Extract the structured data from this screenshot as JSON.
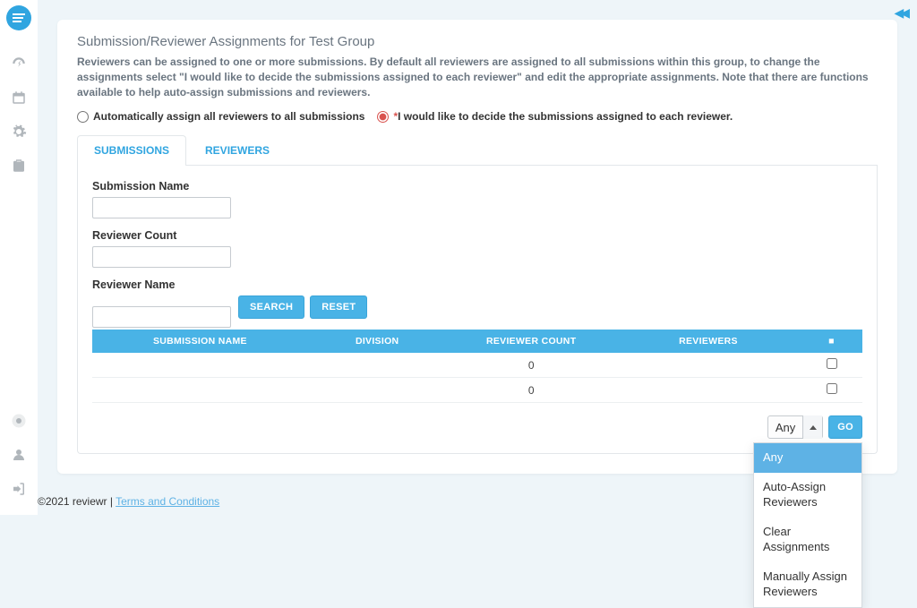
{
  "header": {
    "title": "Submission/Reviewer Assignments for Test Group",
    "description": "Reviewers can be assigned to one or more submissions. By default all reviewers are assigned to all submissions within this group, to change the assignments select \"I would like to decide the submissions assigned to each reviewer\" and edit the appropriate assignments. Note that there are functions available to help auto-assign submissions and reviewers."
  },
  "assign_mode": {
    "auto_label": "Automatically assign all reviewers to all submissions",
    "manual_label": "I would like to decide the submissions assigned to each reviewer."
  },
  "tabs": {
    "submissions": "SUBMISSIONS",
    "reviewers": "REVIEWERS"
  },
  "filters": {
    "submission_name_label": "Submission Name",
    "reviewer_count_label": "Reviewer Count",
    "reviewer_name_label": "Reviewer Name",
    "search_btn": "SEARCH",
    "reset_btn": "RESET"
  },
  "table": {
    "headers": {
      "submission_name": "SUBMISSION NAME",
      "division": "DIVISION",
      "reviewer_count": "REVIEWER COUNT",
      "reviewers": "REVIEWERS",
      "select_all": "■"
    },
    "rows": [
      {
        "submission_name": "",
        "division": "",
        "reviewer_count": "0",
        "reviewers": ""
      },
      {
        "submission_name": "",
        "division": "",
        "reviewer_count": "0",
        "reviewers": ""
      }
    ]
  },
  "action": {
    "selected": "Any",
    "go_btn": "GO",
    "options": [
      "Any",
      "Auto-Assign Reviewers",
      "Clear Assignments",
      "Manually Assign Reviewers"
    ]
  },
  "footer": {
    "copyright": "©2021 reviewr | ",
    "terms": "Terms and Conditions"
  }
}
